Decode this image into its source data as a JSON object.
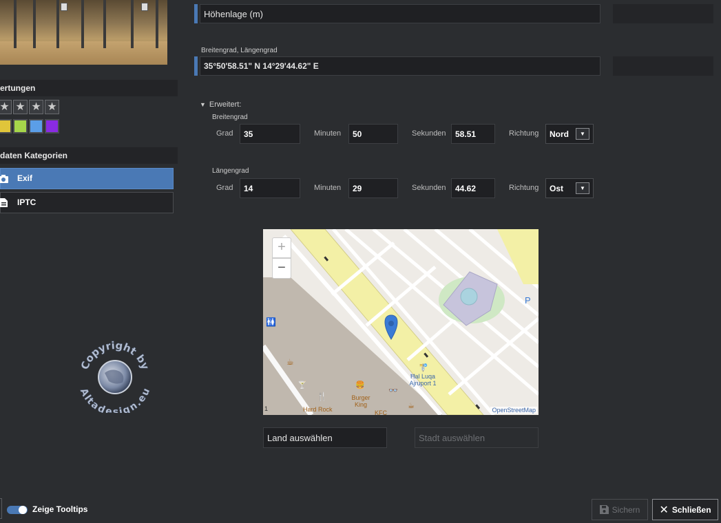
{
  "sidebar": {
    "ratings_title": "ertungen",
    "stars": [
      "★",
      "★",
      "★",
      "★"
    ],
    "color_labels": [
      "#e0c53a",
      "#a6d64a",
      "#5b9ee8",
      "#8a2be2"
    ],
    "categories_title": "daten Kategorien",
    "categories": [
      {
        "label": "Exif",
        "icon": "camera-icon",
        "selected": true
      },
      {
        "label": "IPTC",
        "icon": "document-icon",
        "selected": false
      }
    ],
    "watermark": {
      "line1": "Copyright by",
      "line2": "Altadesign.eu"
    }
  },
  "form": {
    "altitude": {
      "value": "Höhenlage (m)"
    },
    "latlong": {
      "label": "Breitengrad, Längengrad",
      "value": "35°50'58.51\" N 14°29'44.62\" E"
    },
    "advanced": {
      "toggle_label": "Erweitert:",
      "latitude": {
        "title": "Breitengrad",
        "grad_label": "Grad",
        "grad": "35",
        "minuten_label": "Minuten",
        "minuten": "50",
        "sekunden_label": "Sekunden",
        "sekunden": "58.51",
        "richtung_label": "Richtung",
        "richtung": "Nord"
      },
      "longitude": {
        "title": "Längengrad",
        "grad_label": "Grad",
        "grad": "14",
        "minuten_label": "Minuten",
        "minuten": "29",
        "sekunden_label": "Sekunden",
        "sekunden": "44.62",
        "richtung_label": "Richtung",
        "richtung": "Ost"
      }
    },
    "map": {
      "zoom_in": "+",
      "zoom_out": "−",
      "attribution": "OpenStreetMap",
      "scale_label": "1",
      "parking": "P",
      "pois": {
        "stop": "Ħal Luqa Ajruport 1",
        "hard_rock": "Hard Rock",
        "burger_king": "Burger King",
        "kfc": "KFC"
      }
    },
    "country_placeholder": "Land auswählen",
    "city_placeholder": "Stadt auswählen"
  },
  "footer": {
    "tooltips_label": "Zeige Tooltips",
    "tooltips_on": true,
    "save_label": "Sichern",
    "close_label": "Schließen"
  },
  "colors": {
    "accent": "#4a79b5",
    "panel": "#2b2d30",
    "field": "#1f2023"
  }
}
